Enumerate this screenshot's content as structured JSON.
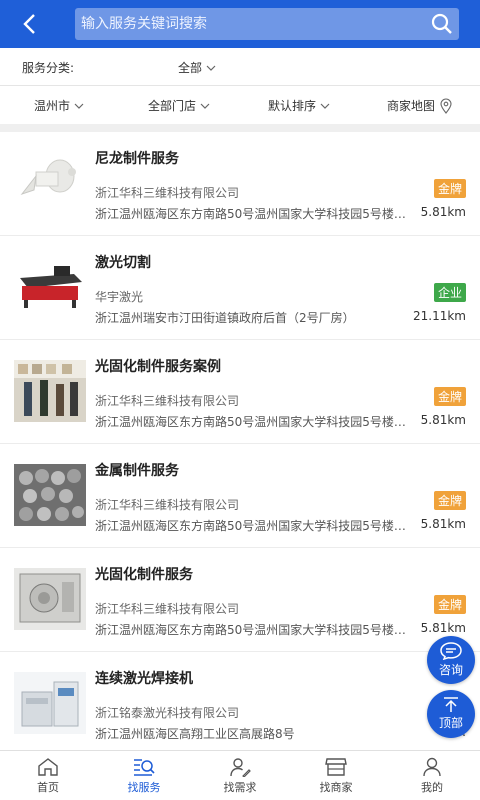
{
  "header": {
    "search_placeholder": "输入服务关键词搜索",
    "back_icon": "chevron-left-icon",
    "search_icon": "search-icon"
  },
  "category": {
    "label": "服务分类:",
    "selected": "全部"
  },
  "filters": [
    {
      "label": "温州市"
    },
    {
      "label": "全部门店"
    },
    {
      "label": "默认排序"
    },
    {
      "label": "商家地图"
    }
  ],
  "items": [
    {
      "title": "尼龙制件服务",
      "company": "浙江华科三维科技有限公司",
      "address": "浙江温州瓯海区东方南路50号温州国家大学科技园5号楼一...",
      "badge": "金牌",
      "badge_type": "gold",
      "distance": "5.81km"
    },
    {
      "title": "激光切割",
      "company": "华宇激光",
      "address": "浙江温州瑞安市汀田街道镇政府后首（2号厂房）",
      "badge": "企业",
      "badge_type": "enterprise",
      "distance": "21.11km"
    },
    {
      "title": "光固化制件服务案例",
      "company": "浙江华科三维科技有限公司",
      "address": "浙江温州瓯海区东方南路50号温州国家大学科技园5号楼一...",
      "badge": "金牌",
      "badge_type": "gold",
      "distance": "5.81km"
    },
    {
      "title": "金属制件服务",
      "company": "浙江华科三维科技有限公司",
      "address": "浙江温州瓯海区东方南路50号温州国家大学科技园5号楼一...",
      "badge": "金牌",
      "badge_type": "gold",
      "distance": "5.81km"
    },
    {
      "title": "光固化制件服务",
      "company": "浙江华科三维科技有限公司",
      "address": "浙江温州瓯海区东方南路50号温州国家大学科技园5号楼一...",
      "badge": "金牌",
      "badge_type": "gold",
      "distance": "5.81km"
    },
    {
      "title": "连续激光焊接机",
      "company": "浙江铭泰激光科技有限公司",
      "address": "浙江温州瓯海区高翔工业区高展路8号",
      "badge": "",
      "badge_type": "",
      "distance": "5."
    }
  ],
  "floating": {
    "consult_label": "咨询",
    "top_label": "顶部"
  },
  "nav": [
    {
      "label": "首页",
      "icon": "home-icon"
    },
    {
      "label": "找服务",
      "icon": "find-service-icon",
      "active": true
    },
    {
      "label": "找需求",
      "icon": "find-demand-icon"
    },
    {
      "label": "找商家",
      "icon": "store-icon"
    },
    {
      "label": "我的",
      "icon": "user-icon"
    }
  ],
  "colors": {
    "primary": "#1f5fd8",
    "gold_badge": "#f0a23a",
    "enterprise_badge": "#3ea84a"
  }
}
